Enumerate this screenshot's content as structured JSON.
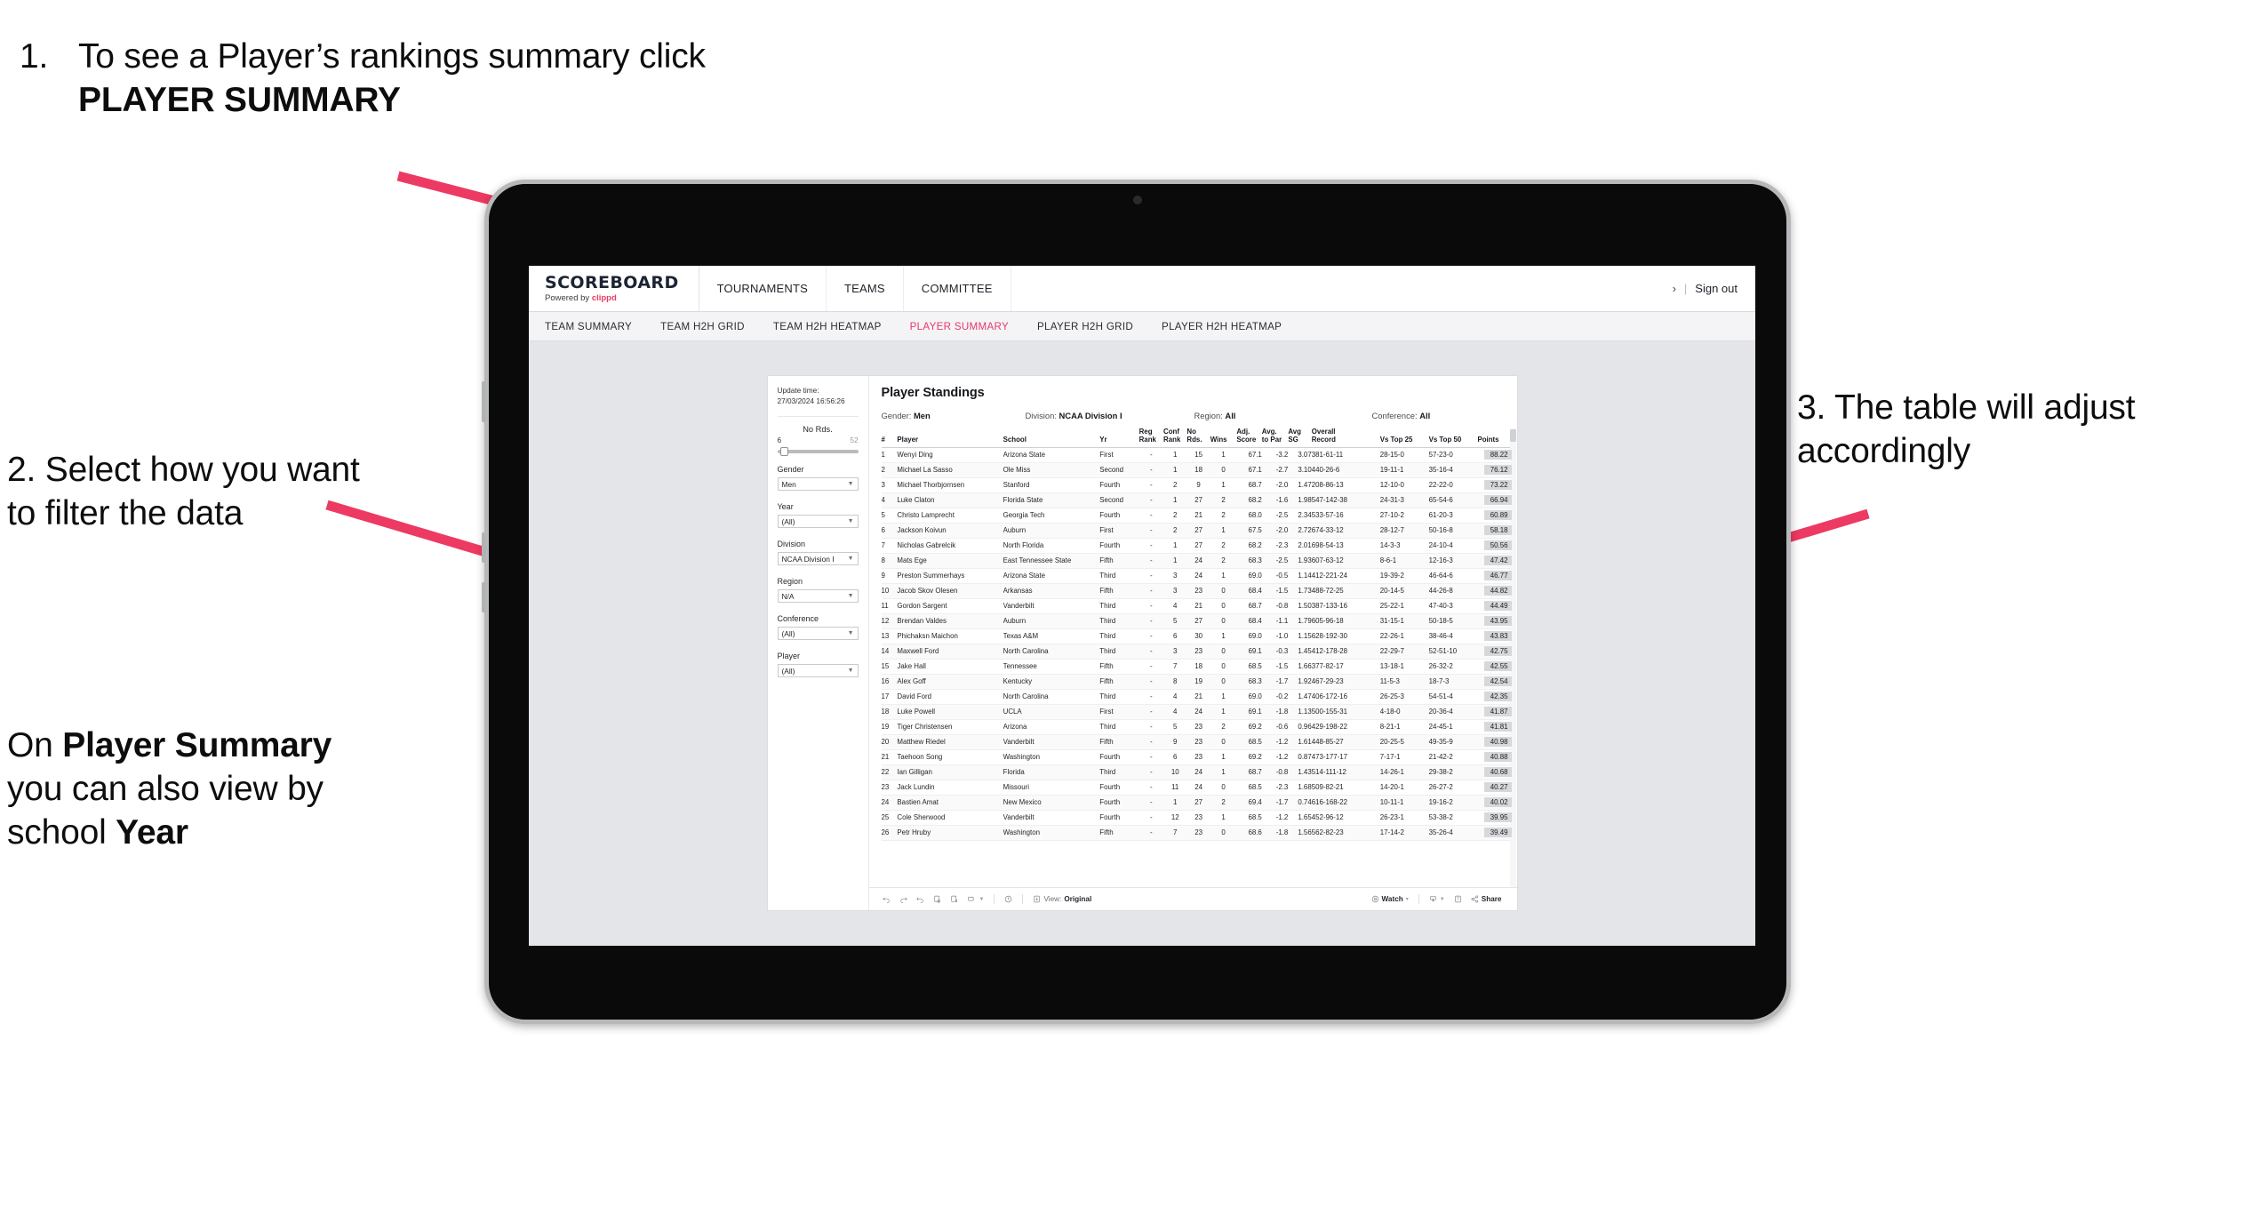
{
  "annotations": {
    "step1": {
      "number": "1.",
      "text_pre": "To see a Player’s rankings summary click ",
      "text_bold": "PLAYER SUMMARY"
    },
    "step2": {
      "text": "2. Select how you want to filter the data"
    },
    "step2b": {
      "pre": "On ",
      "bold1": "Player Summary",
      "mid": " you can also view by school ",
      "bold2": "Year"
    },
    "step3": {
      "text": "3. The table will adjust accordingly"
    },
    "accent_color": "#ec3a62"
  },
  "app": {
    "brand": {
      "title": "SCOREBOARD",
      "powered_by": "Powered by ",
      "vendor": "clippd"
    },
    "nav": [
      {
        "label": "TOURNAMENTS"
      },
      {
        "label": "TEAMS"
      },
      {
        "label": "COMMITTEE"
      }
    ],
    "account": {
      "chevron": "›",
      "separator": "|",
      "sign_out": "Sign out"
    },
    "subnav": [
      {
        "label": "TEAM SUMMARY",
        "active": false
      },
      {
        "label": "TEAM H2H GRID",
        "active": false
      },
      {
        "label": "TEAM H2H HEATMAP",
        "active": false
      },
      {
        "label": "PLAYER SUMMARY",
        "active": true
      },
      {
        "label": "PLAYER H2H GRID",
        "active": false
      },
      {
        "label": "PLAYER H2H HEATMAP",
        "active": false
      }
    ]
  },
  "sidebar": {
    "update_label": "Update time:",
    "update_value": "27/03/2024 16:56:26",
    "slider": {
      "label": "No Rds.",
      "min": "6",
      "max": "52"
    },
    "filters": [
      {
        "label": "Gender",
        "value": "Men"
      },
      {
        "label": "Year",
        "value": "(All)"
      },
      {
        "label": "Division",
        "value": "NCAA Division I"
      },
      {
        "label": "Region",
        "value": "N/A"
      },
      {
        "label": "Conference",
        "value": "(All)"
      },
      {
        "label": "Player",
        "value": "(All)"
      }
    ]
  },
  "panel": {
    "title": "Player Standings",
    "summary": [
      {
        "label": "Gender: ",
        "value": "Men"
      },
      {
        "label": "Division: ",
        "value": "NCAA Division I"
      },
      {
        "label": "Region: ",
        "value": "All"
      },
      {
        "label": "Conference: ",
        "value": "All"
      }
    ]
  },
  "table": {
    "columns": [
      {
        "key": "rank",
        "l1": "#",
        "l2": ""
      },
      {
        "key": "player",
        "l1": "Player",
        "l2": ""
      },
      {
        "key": "school",
        "l1": "School",
        "l2": ""
      },
      {
        "key": "yr",
        "l1": "Yr",
        "l2": ""
      },
      {
        "key": "reg",
        "l1": "Reg",
        "l2": "Rank"
      },
      {
        "key": "conf",
        "l1": "Conf",
        "l2": "Rank"
      },
      {
        "key": "nords",
        "l1": "No",
        "l2": "Rds."
      },
      {
        "key": "wins",
        "l1": "Wins",
        "l2": ""
      },
      {
        "key": "adj",
        "l1": "Adj.",
        "l2": "Score"
      },
      {
        "key": "atp",
        "l1": "Avg.",
        "l2": "to Par"
      },
      {
        "key": "sg",
        "l1": "Avg",
        "l2": "SG"
      },
      {
        "key": "ovr",
        "l1": "Overall",
        "l2": "Record"
      },
      {
        "key": "t25",
        "l1": "Vs Top 25",
        "l2": ""
      },
      {
        "key": "t50",
        "l1": "Vs Top 50",
        "l2": ""
      },
      {
        "key": "pts",
        "l1": "Points",
        "l2": ""
      }
    ],
    "rows": [
      [
        "1",
        "Wenyi Ding",
        "Arizona State",
        "First",
        "-",
        "1",
        "15",
        "1",
        "67.1",
        "-3.2",
        "3.07",
        "381-61-11",
        "28-15-0",
        "57-23-0",
        "88.22"
      ],
      [
        "2",
        "Michael La Sasso",
        "Ole Miss",
        "Second",
        "-",
        "1",
        "18",
        "0",
        "67.1",
        "-2.7",
        "3.10",
        "440-26-6",
        "19-11-1",
        "35-16-4",
        "76.12"
      ],
      [
        "3",
        "Michael Thorbjornsen",
        "Stanford",
        "Fourth",
        "-",
        "2",
        "9",
        "1",
        "68.7",
        "-2.0",
        "1.47",
        "208-86-13",
        "12-10-0",
        "22-22-0",
        "73.22"
      ],
      [
        "4",
        "Luke Claton",
        "Florida State",
        "Second",
        "-",
        "1",
        "27",
        "2",
        "68.2",
        "-1.6",
        "1.98",
        "547-142-38",
        "24-31-3",
        "65-54-6",
        "66.94"
      ],
      [
        "5",
        "Christo Lamprecht",
        "Georgia Tech",
        "Fourth",
        "-",
        "2",
        "21",
        "2",
        "68.0",
        "-2.5",
        "2.34",
        "533-57-16",
        "27-10-2",
        "61-20-3",
        "60.89"
      ],
      [
        "6",
        "Jackson Koivun",
        "Auburn",
        "First",
        "-",
        "2",
        "27",
        "1",
        "67.5",
        "-2.0",
        "2.72",
        "674-33-12",
        "28-12-7",
        "50-16-8",
        "58.18"
      ],
      [
        "7",
        "Nicholas Gabrelcik",
        "North Florida",
        "Fourth",
        "-",
        "1",
        "27",
        "2",
        "68.2",
        "-2.3",
        "2.01",
        "698-54-13",
        "14-3-3",
        "24-10-4",
        "50.56"
      ],
      [
        "8",
        "Mats Ege",
        "East Tennessee State",
        "Fifth",
        "-",
        "1",
        "24",
        "2",
        "68.3",
        "-2.5",
        "1.93",
        "607-63-12",
        "8-6-1",
        "12-16-3",
        "47.42"
      ],
      [
        "9",
        "Preston Summerhays",
        "Arizona State",
        "Third",
        "-",
        "3",
        "24",
        "1",
        "69.0",
        "-0.5",
        "1.14",
        "412-221-24",
        "19-39-2",
        "46-64-6",
        "46.77"
      ],
      [
        "10",
        "Jacob Skov Olesen",
        "Arkansas",
        "Fifth",
        "-",
        "3",
        "23",
        "0",
        "68.4",
        "-1.5",
        "1.73",
        "488-72-25",
        "20-14-5",
        "44-26-8",
        "44.82"
      ],
      [
        "11",
        "Gordon Sargent",
        "Vanderbilt",
        "Third",
        "-",
        "4",
        "21",
        "0",
        "68.7",
        "-0.8",
        "1.50",
        "387-133-16",
        "25-22-1",
        "47-40-3",
        "44.49"
      ],
      [
        "12",
        "Brendan Valdes",
        "Auburn",
        "Third",
        "-",
        "5",
        "27",
        "0",
        "68.4",
        "-1.1",
        "1.79",
        "605-96-18",
        "31-15-1",
        "50-18-5",
        "43.95"
      ],
      [
        "13",
        "Phichaksn Maichon",
        "Texas A&M",
        "Third",
        "-",
        "6",
        "30",
        "1",
        "69.0",
        "-1.0",
        "1.15",
        "628-192-30",
        "22-26-1",
        "38-46-4",
        "43.83"
      ],
      [
        "14",
        "Maxwell Ford",
        "North Carolina",
        "Third",
        "-",
        "3",
        "23",
        "0",
        "69.1",
        "-0.3",
        "1.45",
        "412-178-28",
        "22-29-7",
        "52-51-10",
        "42.75"
      ],
      [
        "15",
        "Jake Hall",
        "Tennessee",
        "Fifth",
        "-",
        "7",
        "18",
        "0",
        "68.5",
        "-1.5",
        "1.66",
        "377-82-17",
        "13-18-1",
        "26-32-2",
        "42.55"
      ],
      [
        "16",
        "Alex Goff",
        "Kentucky",
        "Fifth",
        "-",
        "8",
        "19",
        "0",
        "68.3",
        "-1.7",
        "1.92",
        "467-29-23",
        "11-5-3",
        "18-7-3",
        "42.54"
      ],
      [
        "17",
        "David Ford",
        "North Carolina",
        "Third",
        "-",
        "4",
        "21",
        "1",
        "69.0",
        "-0.2",
        "1.47",
        "406-172-16",
        "26-25-3",
        "54-51-4",
        "42.35"
      ],
      [
        "18",
        "Luke Powell",
        "UCLA",
        "First",
        "-",
        "4",
        "24",
        "1",
        "69.1",
        "-1.8",
        "1.13",
        "500-155-31",
        "4-18-0",
        "20-36-4",
        "41.87"
      ],
      [
        "19",
        "Tiger Christensen",
        "Arizona",
        "Third",
        "-",
        "5",
        "23",
        "2",
        "69.2",
        "-0.6",
        "0.96",
        "429-198-22",
        "8-21-1",
        "24-45-1",
        "41.81"
      ],
      [
        "20",
        "Matthew Riedel",
        "Vanderbilt",
        "Fifth",
        "-",
        "9",
        "23",
        "0",
        "68.5",
        "-1.2",
        "1.61",
        "448-85-27",
        "20-25-5",
        "49-35-9",
        "40.98"
      ],
      [
        "21",
        "Taehoon Song",
        "Washington",
        "Fourth",
        "-",
        "6",
        "23",
        "1",
        "69.2",
        "-1.2",
        "0.87",
        "473-177-17",
        "7-17-1",
        "21-42-2",
        "40.88"
      ],
      [
        "22",
        "Ian Gilligan",
        "Florida",
        "Third",
        "-",
        "10",
        "24",
        "1",
        "68.7",
        "-0.8",
        "1.43",
        "514-111-12",
        "14-26-1",
        "29-38-2",
        "40.68"
      ],
      [
        "23",
        "Jack Lundin",
        "Missouri",
        "Fourth",
        "-",
        "11",
        "24",
        "0",
        "68.5",
        "-2.3",
        "1.68",
        "509-82-21",
        "14-20-1",
        "26-27-2",
        "40.27"
      ],
      [
        "24",
        "Bastien Amat",
        "New Mexico",
        "Fourth",
        "-",
        "1",
        "27",
        "2",
        "69.4",
        "-1.7",
        "0.74",
        "616-168-22",
        "10-11-1",
        "19-16-2",
        "40.02"
      ],
      [
        "25",
        "Cole Sherwood",
        "Vanderbilt",
        "Fourth",
        "-",
        "12",
        "23",
        "1",
        "68.5",
        "-1.2",
        "1.65",
        "452-96-12",
        "26-23-1",
        "53-38-2",
        "39.95"
      ],
      [
        "26",
        "Petr Hruby",
        "Washington",
        "Fifth",
        "-",
        "7",
        "23",
        "0",
        "68.6",
        "-1.8",
        "1.56",
        "562-82-23",
        "17-14-2",
        "35-26-4",
        "39.49"
      ]
    ]
  },
  "toolbar": {
    "view_label": "View: ",
    "view_value": "Original",
    "watch_label": "Watch",
    "share_label": "Share",
    "caret": "▾"
  }
}
